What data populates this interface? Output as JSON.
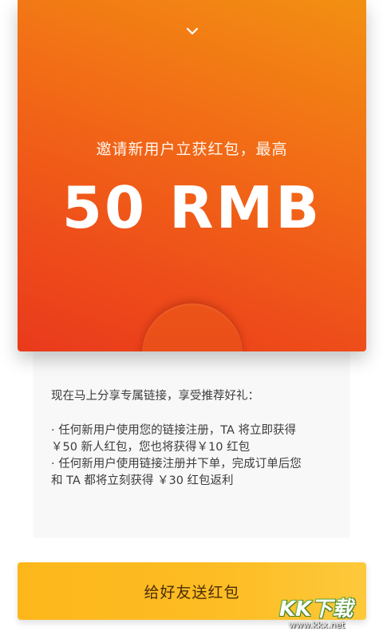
{
  "envelope": {
    "collapse_icon": "chevron-down-icon",
    "title": "邀请新用户立获红包，最高",
    "amount": "50 RMB",
    "colors": {
      "top": "#f29012",
      "bottom": "#e93a1c",
      "seal": "#e8461b"
    }
  },
  "rules": {
    "intro": "现在马上分享专属链接，享受推荐好礼：",
    "items": [
      "· 任何新用户使用您的链接注册，TA 将立即获得\n￥50 新人红包，您也将获得￥10 红包",
      "· 任何新用户使用链接注册并下单，完成订单后您\n和 TA 都将立刻获得 ￥30 红包返利"
    ]
  },
  "action": {
    "send_label": "给好友送红包",
    "color": "#fdbd24"
  },
  "watermark": {
    "logo": "KK下载",
    "url": "www.kkx.net"
  }
}
